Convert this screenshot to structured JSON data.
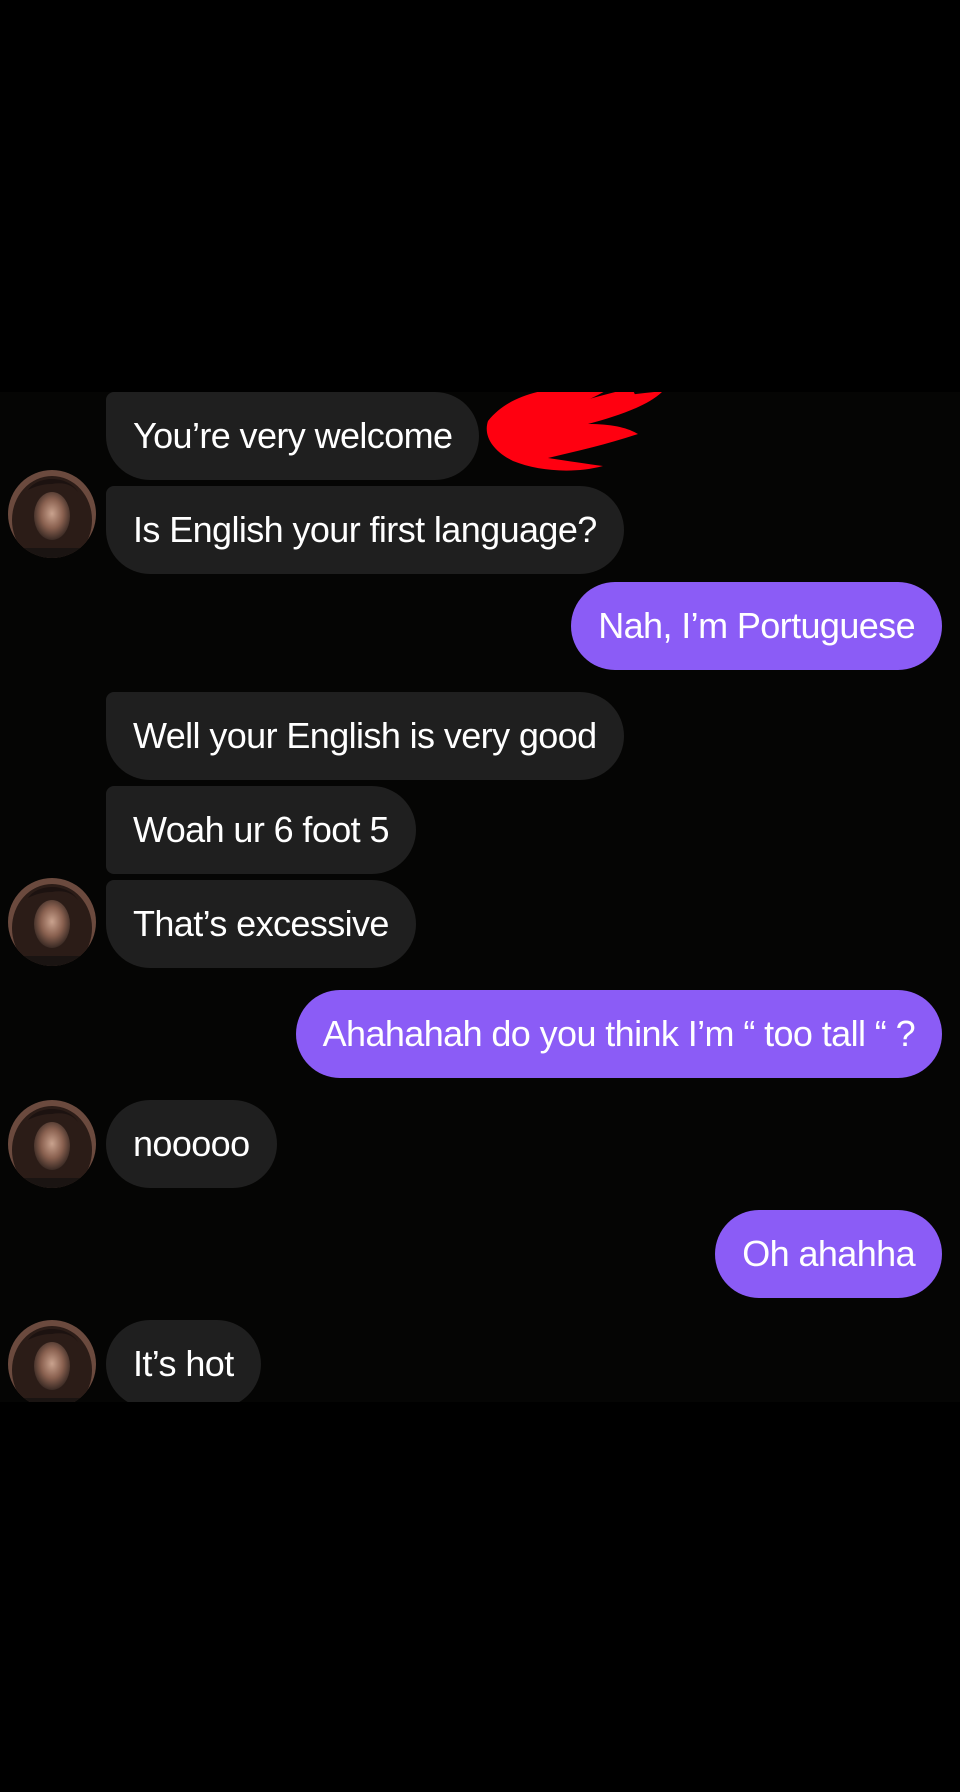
{
  "conversation": {
    "messages": [
      {
        "from": "them",
        "text": "You’re very welcome"
      },
      {
        "from": "them",
        "text": "Is English your first language?"
      },
      {
        "from": "me",
        "text": "Nah, I’m Portuguese"
      },
      {
        "from": "them",
        "text": "Well your English is very good"
      },
      {
        "from": "them",
        "text": "Woah ur 6 foot 5"
      },
      {
        "from": "them",
        "text": "That’s excessive"
      },
      {
        "from": "me",
        "text": "Ahahahah do you think I’m “ too tall “ ?"
      },
      {
        "from": "them",
        "text": "nooooo"
      },
      {
        "from": "me",
        "text": "Oh ahahha"
      },
      {
        "from": "them",
        "text": "It’s hot"
      }
    ]
  },
  "colors": {
    "incoming_bubble": "#1f1f1f",
    "outgoing_bubble": "#8b5cf6",
    "background": "#050504",
    "redaction": "#ff0010"
  },
  "icons": {
    "avatar": "contact-avatar-photo",
    "redaction": "red-scribble-redaction"
  }
}
